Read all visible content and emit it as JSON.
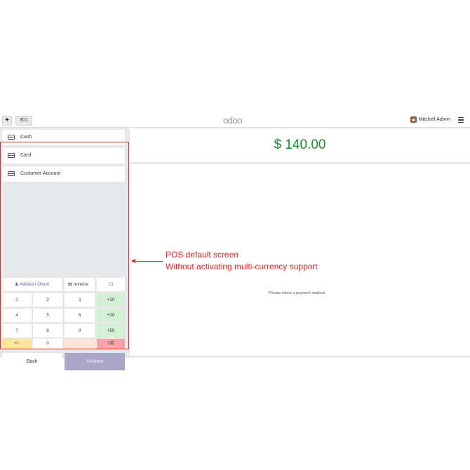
{
  "topbar": {
    "order_number": "301",
    "logo": "odoo",
    "user_name": "Mitchell Admin"
  },
  "payment_methods": [
    {
      "label": "Cash"
    },
    {
      "label": "Card"
    },
    {
      "label": "Customer Account"
    }
  ],
  "customer": {
    "name": "Addison Olson",
    "invoice_label": "Invoice"
  },
  "numpad": {
    "keys": [
      "1",
      "2",
      "3",
      "+10",
      "4",
      "5",
      "6",
      "+20",
      "7",
      "8",
      "9",
      "+50",
      "+/-",
      "0",
      ".",
      "⌫"
    ]
  },
  "actions": {
    "back": "Back",
    "validate": "Validate"
  },
  "total": "$ 140.00",
  "hint": "Please select a payment method",
  "annotation": {
    "line1": "POS default screen",
    "line2": "Without activating multi-currency support"
  },
  "colors": {
    "accent": "#e02424",
    "total": "#1f8a2f",
    "validate": "#a9a6c8"
  }
}
